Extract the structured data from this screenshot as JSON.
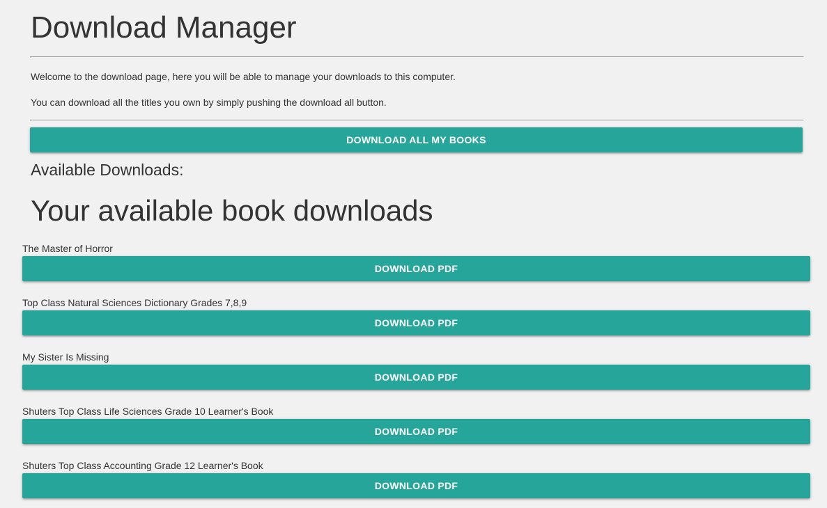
{
  "header": {
    "title": "Download Manager"
  },
  "intro": {
    "line1": "Welcome to the download page, here you will be able to manage your downloads to this computer.",
    "line2": "You can download all the titles you own by simply pushing the download all button."
  },
  "download_all": {
    "label": "DOWNLOAD ALL MY BOOKS"
  },
  "available": {
    "label": "Available Downloads:",
    "heading": "Your available book downloads"
  },
  "books": [
    {
      "title": "The Master of Horror",
      "button_label": "DOWNLOAD PDF"
    },
    {
      "title": "Top Class Natural Sciences Dictionary Grades 7,8,9",
      "button_label": "DOWNLOAD PDF"
    },
    {
      "title": "My Sister Is Missing",
      "button_label": "DOWNLOAD PDF"
    },
    {
      "title": "Shuters Top Class Life Sciences Grade 10 Learner's Book",
      "button_label": "DOWNLOAD PDF"
    },
    {
      "title": "Shuters Top Class Accounting Grade 12 Learner's Book",
      "button_label": "DOWNLOAD PDF"
    }
  ],
  "colors": {
    "background": "#f1f1f1",
    "button": "#26a69a",
    "button_text": "#ffffff",
    "text": "#333333",
    "rule": "#9e9e9e"
  }
}
